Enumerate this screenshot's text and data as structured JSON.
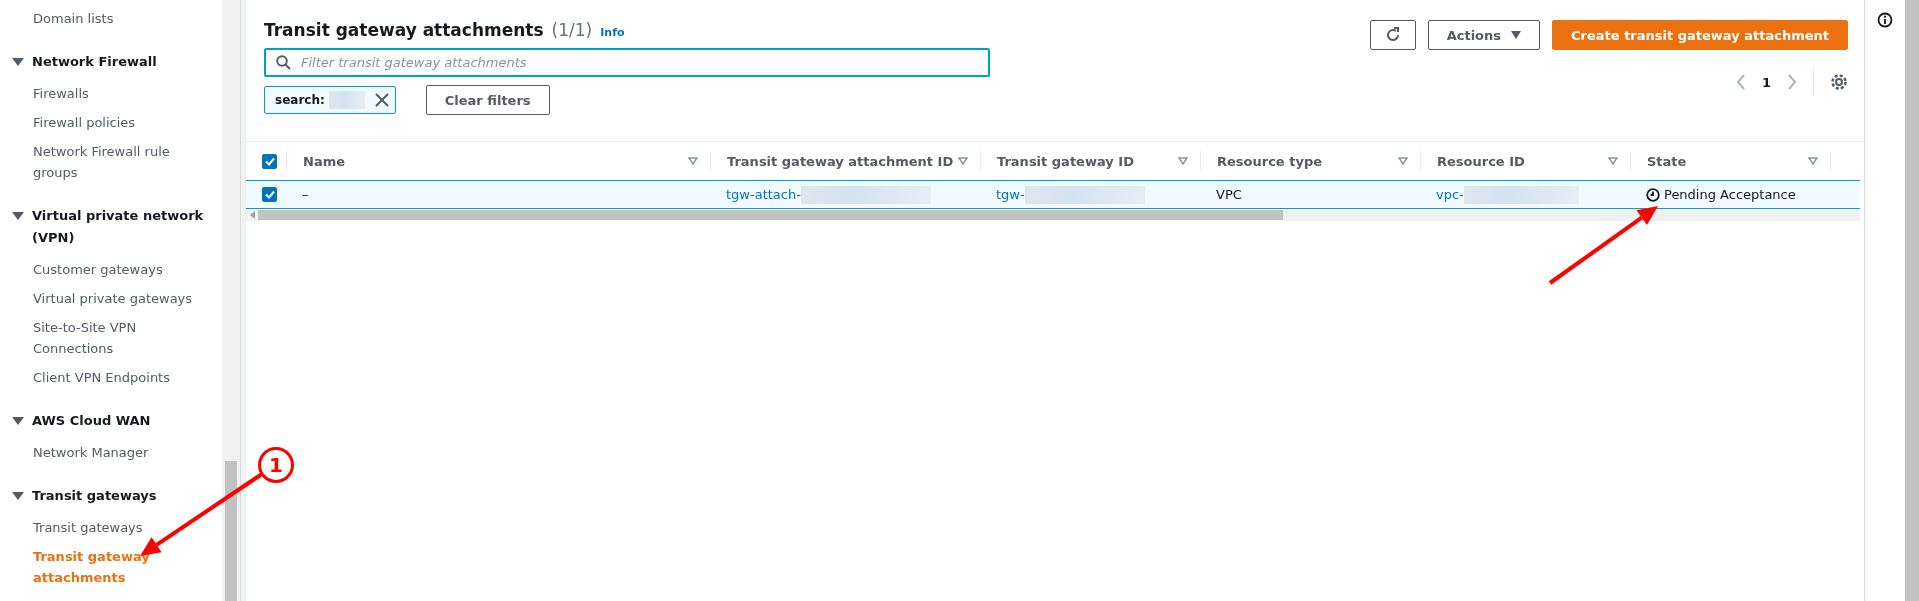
{
  "sidebar": {
    "sections": [
      {
        "items": [
          {
            "label": "Domain lists",
            "selected": false
          }
        ]
      },
      {
        "title": "Network Firewall",
        "expanded": true,
        "items": [
          {
            "label": "Firewalls",
            "selected": false
          },
          {
            "label": "Firewall policies",
            "selected": false
          },
          {
            "label": "Network Firewall rule groups",
            "selected": false
          }
        ]
      },
      {
        "title": "Virtual private network (VPN)",
        "expanded": true,
        "items": [
          {
            "label": "Customer gateways",
            "selected": false
          },
          {
            "label": "Virtual private gateways",
            "selected": false
          },
          {
            "label": "Site-to-Site VPN Connections",
            "selected": false
          },
          {
            "label": "Client VPN Endpoints",
            "selected": false
          }
        ]
      },
      {
        "title": "AWS Cloud WAN",
        "expanded": true,
        "items": [
          {
            "label": "Network Manager",
            "selected": false
          }
        ]
      },
      {
        "title": "Transit gateways",
        "expanded": true,
        "items": [
          {
            "label": "Transit gateways",
            "selected": false
          },
          {
            "label": "Transit gateway attachments",
            "selected": true
          }
        ]
      }
    ]
  },
  "panel": {
    "title": "Transit gateway attachments",
    "count": "(1/1)",
    "info": "Info",
    "actions": "Actions",
    "create": "Create transit gateway attachment",
    "search": {
      "placeholder": "Filter transit gateway attachments"
    },
    "filter_chip": {
      "label": "search:"
    },
    "clear_filters": "Clear filters",
    "page": "1"
  },
  "table": {
    "all_selected": true,
    "columns": [
      "Name",
      "Transit gateway attachment ID",
      "Transit gateway ID",
      "Resource type",
      "Resource ID",
      "State"
    ],
    "rows": [
      {
        "selected": true,
        "cells": [
          {
            "kind": "text",
            "text": "–"
          },
          {
            "kind": "link",
            "text": "tgw-attach-",
            "redacted": true
          },
          {
            "kind": "link",
            "text": "tgw-",
            "redacted": true
          },
          {
            "kind": "text",
            "text": "VPC"
          },
          {
            "kind": "link",
            "text": "vpc-",
            "redacted": true
          },
          {
            "kind": "status",
            "text": "Pending Acceptance"
          }
        ]
      }
    ]
  },
  "annotations": {
    "marker": "1"
  }
}
